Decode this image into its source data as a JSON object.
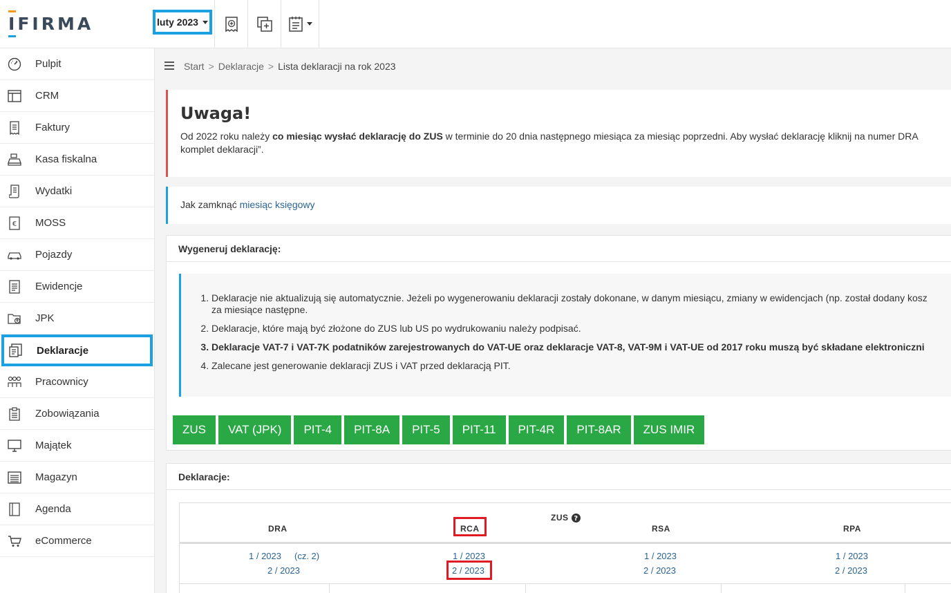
{
  "header": {
    "logo_text": "IFIRMA",
    "month_selector": "luty 2023"
  },
  "sidebar": {
    "items": [
      {
        "label": "Pulpit",
        "icon": "speedometer-icon"
      },
      {
        "label": "CRM",
        "icon": "table-icon"
      },
      {
        "label": "Faktury",
        "icon": "invoice-icon"
      },
      {
        "label": "Kasa fiskalna",
        "icon": "cash-register-icon"
      },
      {
        "label": "Wydatki",
        "icon": "receipt-icon"
      },
      {
        "label": "MOSS",
        "icon": "euro-doc-icon"
      },
      {
        "label": "Pojazdy",
        "icon": "car-icon"
      },
      {
        "label": "Ewidencje",
        "icon": "ledger-icon"
      },
      {
        "label": "JPK",
        "icon": "folder-upload-icon"
      },
      {
        "label": "Deklaracje",
        "icon": "declaration-icon",
        "active": true
      },
      {
        "label": "Pracownicy",
        "icon": "people-icon"
      },
      {
        "label": "Zobowiązania",
        "icon": "clipboard-icon"
      },
      {
        "label": "Majątek",
        "icon": "monitor-icon"
      },
      {
        "label": "Magazyn",
        "icon": "warehouse-icon"
      },
      {
        "label": "Agenda",
        "icon": "agenda-icon"
      },
      {
        "label": "eCommerce",
        "icon": "cart-icon"
      }
    ]
  },
  "breadcrumb": {
    "start": "Start",
    "sep": ">",
    "section": "Deklaracje",
    "current": "Lista deklaracji na rok 2023"
  },
  "alert": {
    "title": "Uwaga!",
    "text_before": "Od 2022 roku należy ",
    "text_bold": "co miesiąc wysłać deklarację do ZUS",
    "text_after": " w terminie do 20 dnia następnego miesiąca za miesiąc poprzedni. Aby wysłać deklarację kliknij na numer DRA",
    "text_line2": "komplet deklaracji”."
  },
  "info": {
    "prefix": "Jak zamknąć ",
    "link": "miesiąc księgowy"
  },
  "generate_panel": {
    "title": "Wygeneruj deklarację:",
    "notes": [
      "Deklaracje nie aktualizują się automatycznie. Jeżeli po wygenerowaniu deklaracji zostały dokonane, w danym miesiącu, zmiany w ewidencjach (np. został dodany kosz",
      "za miesiące następne.",
      "Deklaracje, które mają być złożone do ZUS lub US po wydrukowaniu należy podpisać.",
      "Deklaracje VAT-7 i VAT-7K podatników zarejestrowanych do VAT-UE oraz deklaracje VAT-8, VAT-9M i VAT-UE od 2017 roku muszą być składane elektroniczni",
      "Zalecane jest generowanie deklaracji ZUS i VAT przed deklaracją PIT."
    ],
    "buttons": [
      "ZUS",
      "VAT (JPK)",
      "PIT-4",
      "PIT-8A",
      "PIT-5",
      "PIT-11",
      "PIT-4R",
      "PIT-8AR",
      "ZUS IMIR"
    ]
  },
  "declarations_panel": {
    "title": "Deklaracje:",
    "group": "ZUS",
    "columns": [
      "DRA",
      "RCA",
      "RSA",
      "RPA"
    ],
    "dra": [
      "1 / 2023",
      "2 / 2023"
    ],
    "dra_part": "(cz. 2)",
    "rca": [
      "1 / 2023",
      "2 / 2023"
    ],
    "rsa": [
      "1 / 2023",
      "2 / 2023"
    ],
    "rpa": [
      "1 / 2023",
      "2 / 2023"
    ]
  },
  "colors": {
    "accent": "#1ba1e2",
    "green_button": "#2aa845",
    "alert_border": "#d9534f",
    "highlight_red": "#e01b24",
    "link": "#2a6496"
  }
}
